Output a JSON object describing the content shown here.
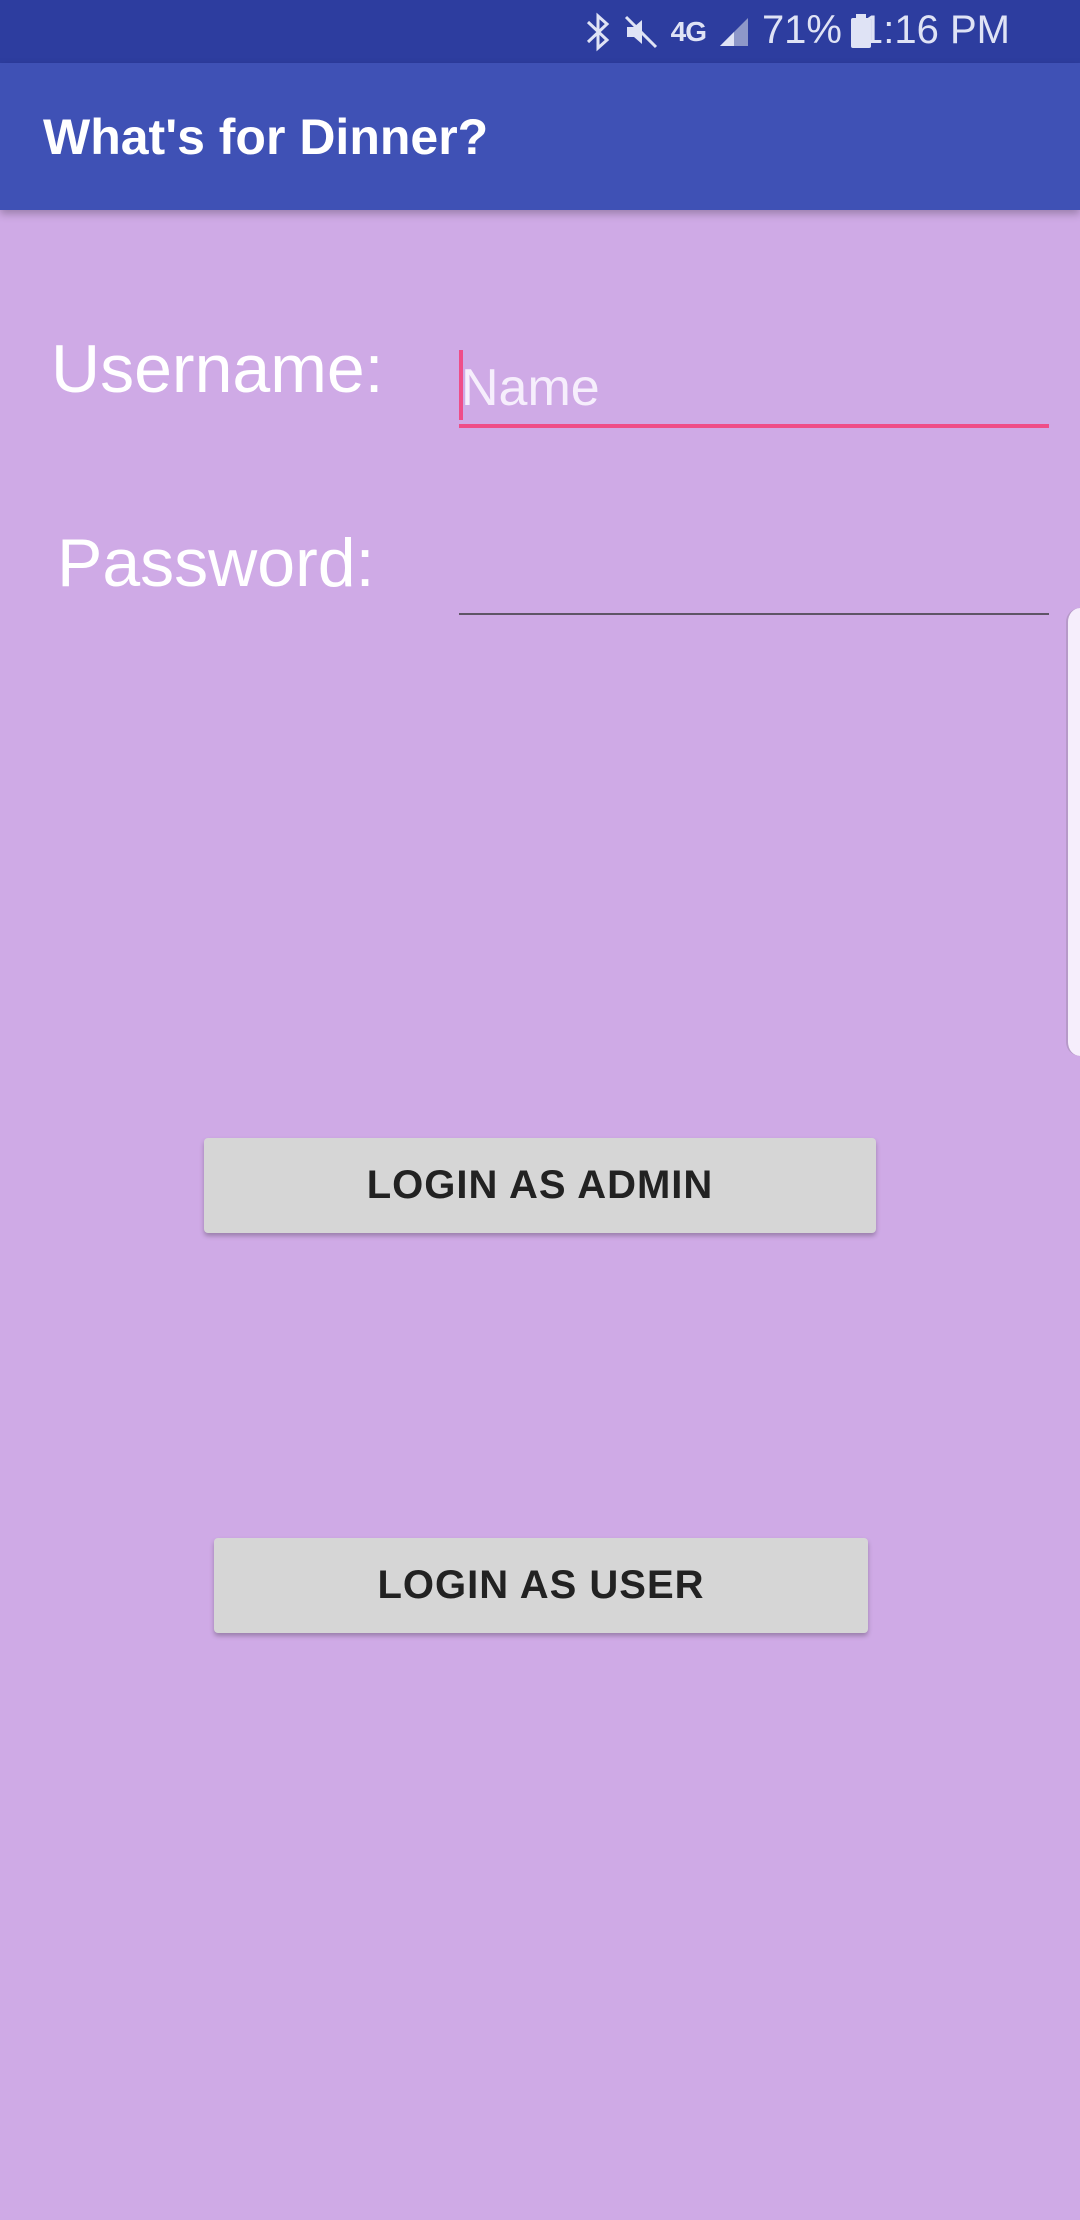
{
  "status_bar": {
    "battery_percent": "71%",
    "time": "1:16 PM",
    "network_label": "4G",
    "icons": [
      "bluetooth-icon",
      "mute-icon",
      "network-4g-icon",
      "signal-icon",
      "battery-icon"
    ]
  },
  "app_bar": {
    "title": "What's for Dinner?"
  },
  "form": {
    "username_label": "Username:",
    "username_placeholder": "Name",
    "password_label": "Password:",
    "password_value": ""
  },
  "buttons": {
    "admin_label": "LOGIN AS ADMIN",
    "user_label": "LOGIN AS USER"
  },
  "colors": {
    "status_bar": "#2d3d9f",
    "app_bar": "#3f51b5",
    "background": "#cfaae6",
    "accent": "#ef4d88",
    "button": "#d6d6d6"
  }
}
